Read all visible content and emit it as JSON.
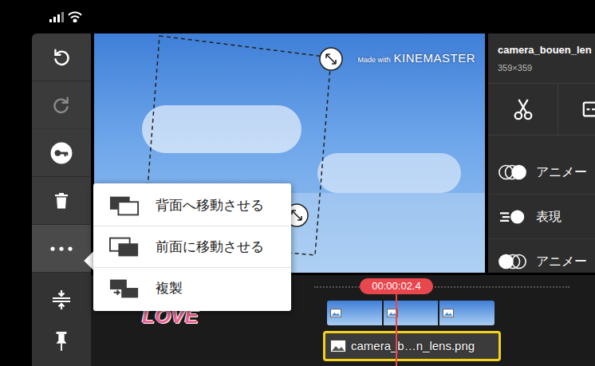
{
  "toolbar": {
    "items": [
      {
        "kind": "undo",
        "disabled": false,
        "expanded": false
      },
      {
        "kind": "redo",
        "disabled": true,
        "expanded": false
      },
      {
        "kind": "key",
        "disabled": false,
        "expanded": false
      },
      {
        "kind": "delete",
        "disabled": false,
        "expanded": false
      },
      {
        "kind": "more",
        "disabled": false,
        "expanded": true
      }
    ],
    "bottom": [
      {
        "kind": "adjust"
      },
      {
        "kind": "pin"
      }
    ]
  },
  "preview": {
    "watermark_prefix": "Made with",
    "watermark_brand": "KINEMASTER",
    "selected_layer": true
  },
  "inspector": {
    "title": "camera_bouen_len",
    "size": "359×359",
    "tools": [
      {
        "kind": "scissors"
      },
      {
        "kind": "split"
      }
    ],
    "options": [
      {
        "label": "アニメー",
        "kind": "anim-in"
      },
      {
        "label": "表現",
        "kind": "express"
      },
      {
        "label": "アニメー",
        "kind": "anim-out"
      }
    ]
  },
  "context_menu": {
    "items": [
      {
        "label": "背面へ移動させる",
        "kind": "send-back"
      },
      {
        "label": "前面に移動させる",
        "kind": "bring-front"
      },
      {
        "label": "複製",
        "kind": "duplicate"
      }
    ]
  },
  "timeline": {
    "time": "00:00:02.4",
    "sticker": "LOVE",
    "clip": {
      "label": "camera_b…n_lens.png",
      "selected": true
    }
  }
}
